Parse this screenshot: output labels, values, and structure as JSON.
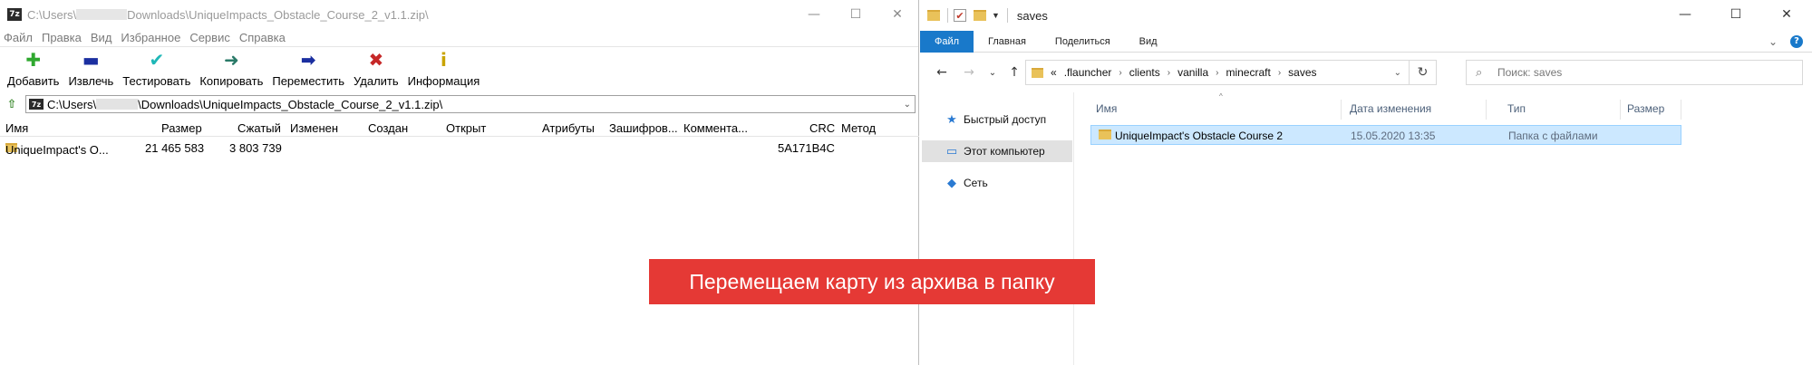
{
  "zip": {
    "title_prefix": "C:\\Users\\",
    "title_suffix": "Downloads\\UniqueImpacts_Obstacle_Course_2_v1.1.zip\\",
    "menu": [
      "Файл",
      "Правка",
      "Вид",
      "Избранное",
      "Сервис",
      "Справка"
    ],
    "toolbar": [
      {
        "label": "Добавить",
        "icon": "add-icon",
        "glyph": "✚",
        "color": "#2fa82f"
      },
      {
        "label": "Извлечь",
        "icon": "extract-icon",
        "glyph": "▬",
        "color": "#1b2fa0"
      },
      {
        "label": "Тестировать",
        "icon": "test-icon",
        "glyph": "✔",
        "color": "#1fb7b7"
      },
      {
        "label": "Копировать",
        "icon": "copy-icon",
        "glyph": "➜",
        "color": "#2a7a68"
      },
      {
        "label": "Переместить",
        "icon": "move-icon",
        "glyph": "➡",
        "color": "#1b2fa0"
      },
      {
        "label": "Удалить",
        "icon": "delete-icon",
        "glyph": "✖",
        "color": "#c62828"
      },
      {
        "label": "Информация",
        "icon": "info-icon",
        "glyph": "i",
        "color": "#c9a400"
      }
    ],
    "address_prefix": "C:\\Users\\",
    "address_suffix": "\\Downloads\\UniqueImpacts_Obstacle_Course_2_v1.1.zip\\",
    "columns": [
      "Имя",
      "Размер",
      "Сжатый",
      "Изменен",
      "Создан",
      "Открыт",
      "Атрибуты",
      "Зашифров...",
      "Коммента...",
      "CRC",
      "Метод"
    ],
    "row": {
      "name": "UniqueImpact's O...",
      "size": "21 465 583",
      "packed": "3 803 739",
      "crc": "5A171B4C"
    }
  },
  "explorer": {
    "title": "saves",
    "ribbon_tabs": [
      "Файл",
      "Главная",
      "Поделиться",
      "Вид"
    ],
    "breadcrumbs": [
      "«",
      ".flauncher",
      "clients",
      "vanilla",
      "minecraft",
      "saves"
    ],
    "search_placeholder": "Поиск: saves",
    "nav": [
      {
        "label": "Быстрый доступ",
        "icon": "star-icon",
        "glyph": "★",
        "color": "#2a7ad2"
      },
      {
        "label": "Этот компьютер",
        "icon": "computer-icon",
        "glyph": "▭",
        "color": "#2a7ad2"
      },
      {
        "label": "Сеть",
        "icon": "network-icon",
        "glyph": "◆",
        "color": "#2a7ad2"
      }
    ],
    "columns": [
      "Имя",
      "Дата изменения",
      "Тип",
      "Размер"
    ],
    "row": {
      "name": "UniqueImpact's Obstacle Course 2",
      "date": "15.05.2020 13:35",
      "type": "Папка с файлами",
      "size": ""
    }
  },
  "caption": "Перемещаем карту из архива в папку"
}
